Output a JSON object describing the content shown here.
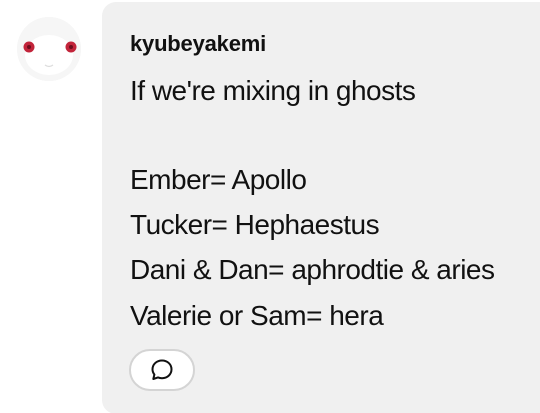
{
  "comment": {
    "username": "kyubeyakemi",
    "lines": [
      "If we're mixing in ghosts",
      "Ember= Apollo",
      "Tucker= Hephaestus",
      "Dani & Dan= aphrodtie & aries",
      "Valerie or Sam= hera"
    ],
    "avatar_icon": "white-creature-avatar-icon",
    "reply_icon": "speech-bubble-icon"
  },
  "colors": {
    "bubble_background": "#f0f0f0",
    "text": "#111111",
    "avatar_eye": "#c2243a"
  }
}
